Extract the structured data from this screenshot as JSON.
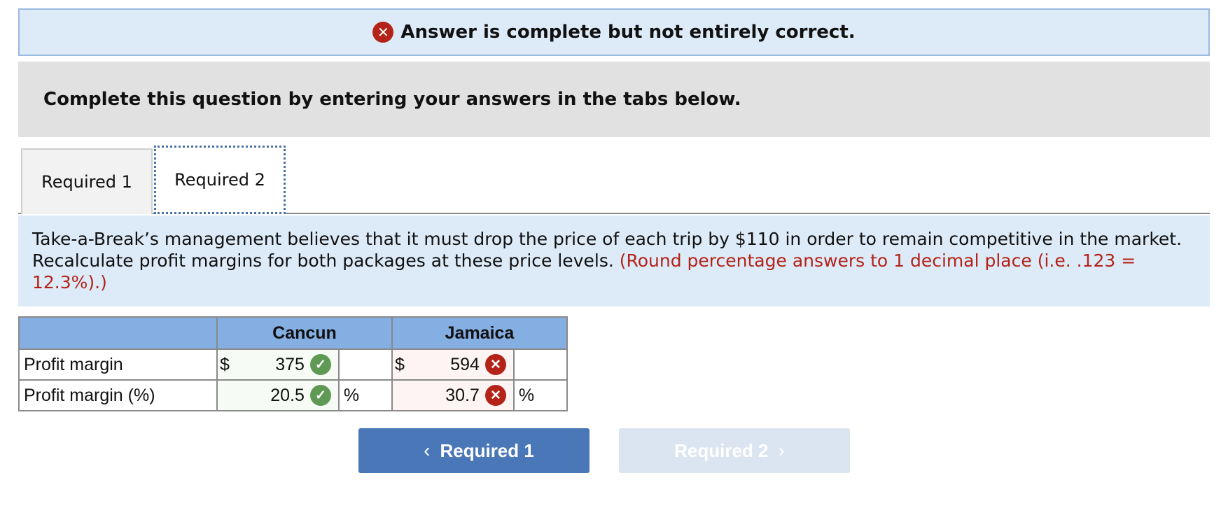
{
  "banner": {
    "icon": "x-circle-icon",
    "text": "Answer is complete but not entirely correct."
  },
  "instruction": "Complete this question by entering your answers in the tabs below.",
  "tabs": [
    {
      "label": "Required 1",
      "selected": false
    },
    {
      "label": "Required 2",
      "selected": true
    }
  ],
  "prompt": {
    "text": "Take-a-Break’s management believes that it must drop the price of each trip by $110 in order to remain competitive in the market. Recalculate profit margins for both packages at these price levels.",
    "hint": "(Round percentage answers to 1 decimal place (i.e. .123 = 12.3%).)"
  },
  "table": {
    "headers": [
      "",
      "Cancun",
      "Jamaica"
    ],
    "rows": [
      {
        "label": "Profit margin",
        "cancun": {
          "prefix": "$",
          "value": "375",
          "status": "correct",
          "suffix": ""
        },
        "jamaica": {
          "prefix": "$",
          "value": "594",
          "status": "incorrect",
          "suffix": ""
        }
      },
      {
        "label": "Profit margin (%)",
        "cancun": {
          "prefix": "",
          "value": "20.5",
          "status": "correct",
          "suffix": "%"
        },
        "jamaica": {
          "prefix": "",
          "value": "30.7",
          "status": "incorrect",
          "suffix": "%"
        }
      }
    ]
  },
  "nav": {
    "prev_label": "Required 1",
    "next_label": "Required 2",
    "next_disabled": true
  },
  "colors": {
    "error": "#b42318",
    "correct": "#5f9a55",
    "header": "#85aee2",
    "button": "#4a77b8",
    "button_disabled": "#dbe5f1"
  }
}
